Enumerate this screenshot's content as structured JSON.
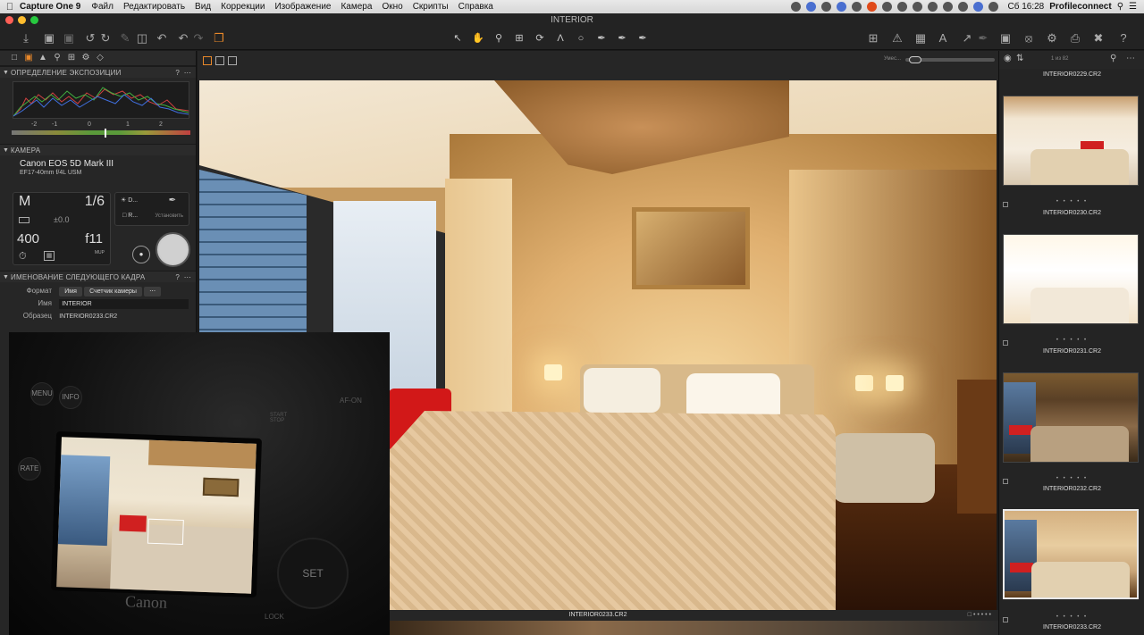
{
  "menubar": {
    "app_name": "Capture One 9",
    "items": [
      "Файл",
      "Редактировать",
      "Вид",
      "Коррекции",
      "Изображение",
      "Камера",
      "Окно",
      "Скрипты",
      "Справка"
    ],
    "clock": "Сб 16:28",
    "user": "Profileconnect"
  },
  "window": {
    "title": "INTERIOR"
  },
  "left_panel": {
    "exposure_header": "ОПРЕДЕЛЕНИЕ ЭКСПОЗИЦИИ",
    "scale_ticks": [
      "-2",
      "-1",
      "0",
      "1",
      "2"
    ],
    "camera_header": "КАМЕРА",
    "camera_model": "Canon EOS 5D Mark III",
    "lens": "EF17-40mm f/4L USM",
    "mode": "M",
    "shutter": "1/6",
    "exposure_comp": "±0.0",
    "iso": "400",
    "aperture": "f11",
    "mirror_up": "MUP",
    "wb_short": "D...",
    "raw_short": "R...",
    "set_label": "Установить",
    "naming_header": "ИМЕНОВАНИЕ СЛЕДУЮЩЕГО КАДРА",
    "format_label": "Формат",
    "format_chip1": "Имя",
    "format_chip2": "Счетчик камеры",
    "name_label": "Имя",
    "name_value": "INTERIOR",
    "sample_label": "Образец",
    "sample_value": "INTERIOR0233.CR2"
  },
  "overlay": {
    "brand": "Canon",
    "buttons": {
      "menu": "MENU",
      "info": "INFO",
      "rate": "RATE",
      "af_on": "AF-ON",
      "start_stop": "START STOP",
      "set": "SET",
      "lock": "LOCK"
    }
  },
  "viewer": {
    "zoom_label": "Умес...",
    "caption": "INTERIOR0233.CR2"
  },
  "browser": {
    "count": "1 из 82",
    "top_caption": "INTERIOR0229.CR2",
    "thumbs": [
      {
        "name": "INTERIOR0230.CR2"
      },
      {
        "name": "INTERIOR0231.CR2"
      },
      {
        "name": "INTERIOR0232.CR2"
      },
      {
        "name": "INTERIOR0233.CR2"
      }
    ]
  }
}
